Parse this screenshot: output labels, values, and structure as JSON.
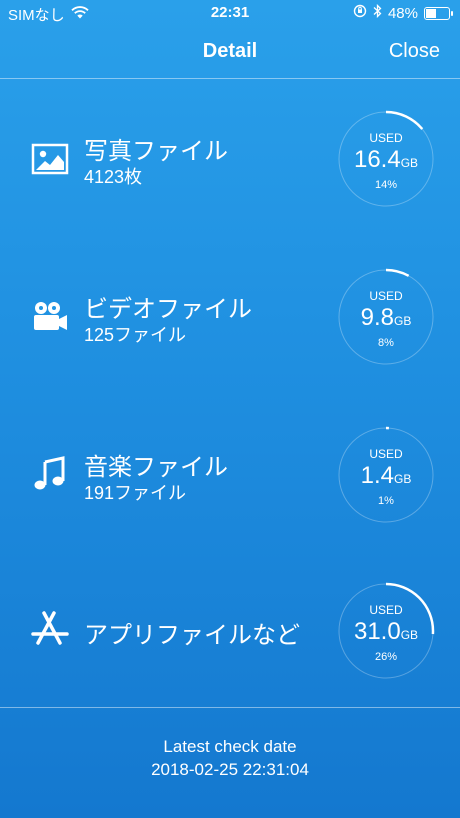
{
  "status_bar": {
    "carrier": "SIMなし",
    "time": "22:31",
    "battery_percent": "48%",
    "battery_level": 0.48
  },
  "nav": {
    "title": "Detail",
    "close_label": "Close"
  },
  "items": [
    {
      "name": "写真ファイル",
      "sub": "4123枚",
      "used_label": "USED",
      "value": "16.4",
      "unit": "GB",
      "percent": "14%",
      "fraction": 0.14,
      "icon": "photo-icon"
    },
    {
      "name": "ビデオファイル",
      "sub": "125ファイル",
      "used_label": "USED",
      "value": "9.8",
      "unit": "GB",
      "percent": "8%",
      "fraction": 0.08,
      "icon": "video-camera-icon"
    },
    {
      "name": "音楽ファイル",
      "sub": "191ファイル",
      "used_label": "USED",
      "value": "1.4",
      "unit": "GB",
      "percent": "1%",
      "fraction": 0.01,
      "icon": "music-note-icon"
    },
    {
      "name": "アプリファイルなど",
      "sub": "",
      "used_label": "USED",
      "value": "31.0",
      "unit": "GB",
      "percent": "26%",
      "fraction": 0.26,
      "icon": "app-store-icon"
    }
  ],
  "footer": {
    "label": "Latest check date",
    "date": "2018-02-25 22:31:04"
  }
}
